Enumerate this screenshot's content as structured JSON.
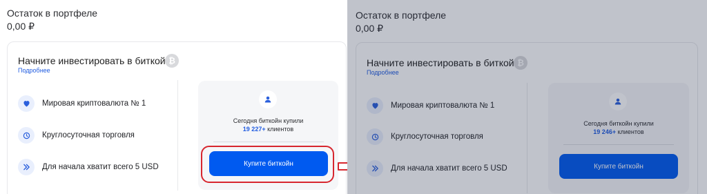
{
  "left": {
    "portfolio": {
      "label": "Остаток в портфеле",
      "value": "0,00 ₽"
    },
    "card": {
      "title": "Начните инвестировать в биткойн",
      "badge": "₿",
      "more_link": "Подробнее",
      "features": [
        {
          "icon": "heart-icon",
          "text": "Мировая криптовалюта № 1"
        },
        {
          "icon": "clock-icon",
          "text": "Круглосуточная торговля"
        },
        {
          "icon": "double-chevron-right-icon",
          "text": "Для начала хватит всего 5 USD"
        }
      ],
      "buy_box": {
        "caption": "Сегодня биткойн купили",
        "count": "19 227+",
        "count_suffix": " клиентов",
        "button": "Купите биткойн"
      }
    }
  },
  "right": {
    "portfolio": {
      "label": "Остаток в портфеле",
      "value": "0,00 ₽"
    },
    "card": {
      "title": "Начните инвестировать в биткойн",
      "badge": "₿",
      "more_link": "Подробнее",
      "features": [
        {
          "icon": "heart-icon",
          "text": "Мировая криптовалюта № 1"
        },
        {
          "icon": "clock-icon",
          "text": "Круглосуточная торговля"
        },
        {
          "icon": "double-chevron-right-icon",
          "text": "Для начала хватит всего 5 USD"
        }
      ],
      "buy_box": {
        "caption": "Сегодня биткойн купили",
        "count": "19 246+",
        "count_suffix": " клиентов",
        "button": "Купите биткойн"
      }
    }
  },
  "colors": {
    "accent": "#005af0",
    "link": "#1f5be0",
    "highlight": "#d7262e",
    "overlay": "rgba(30,40,70,0.28)"
  }
}
